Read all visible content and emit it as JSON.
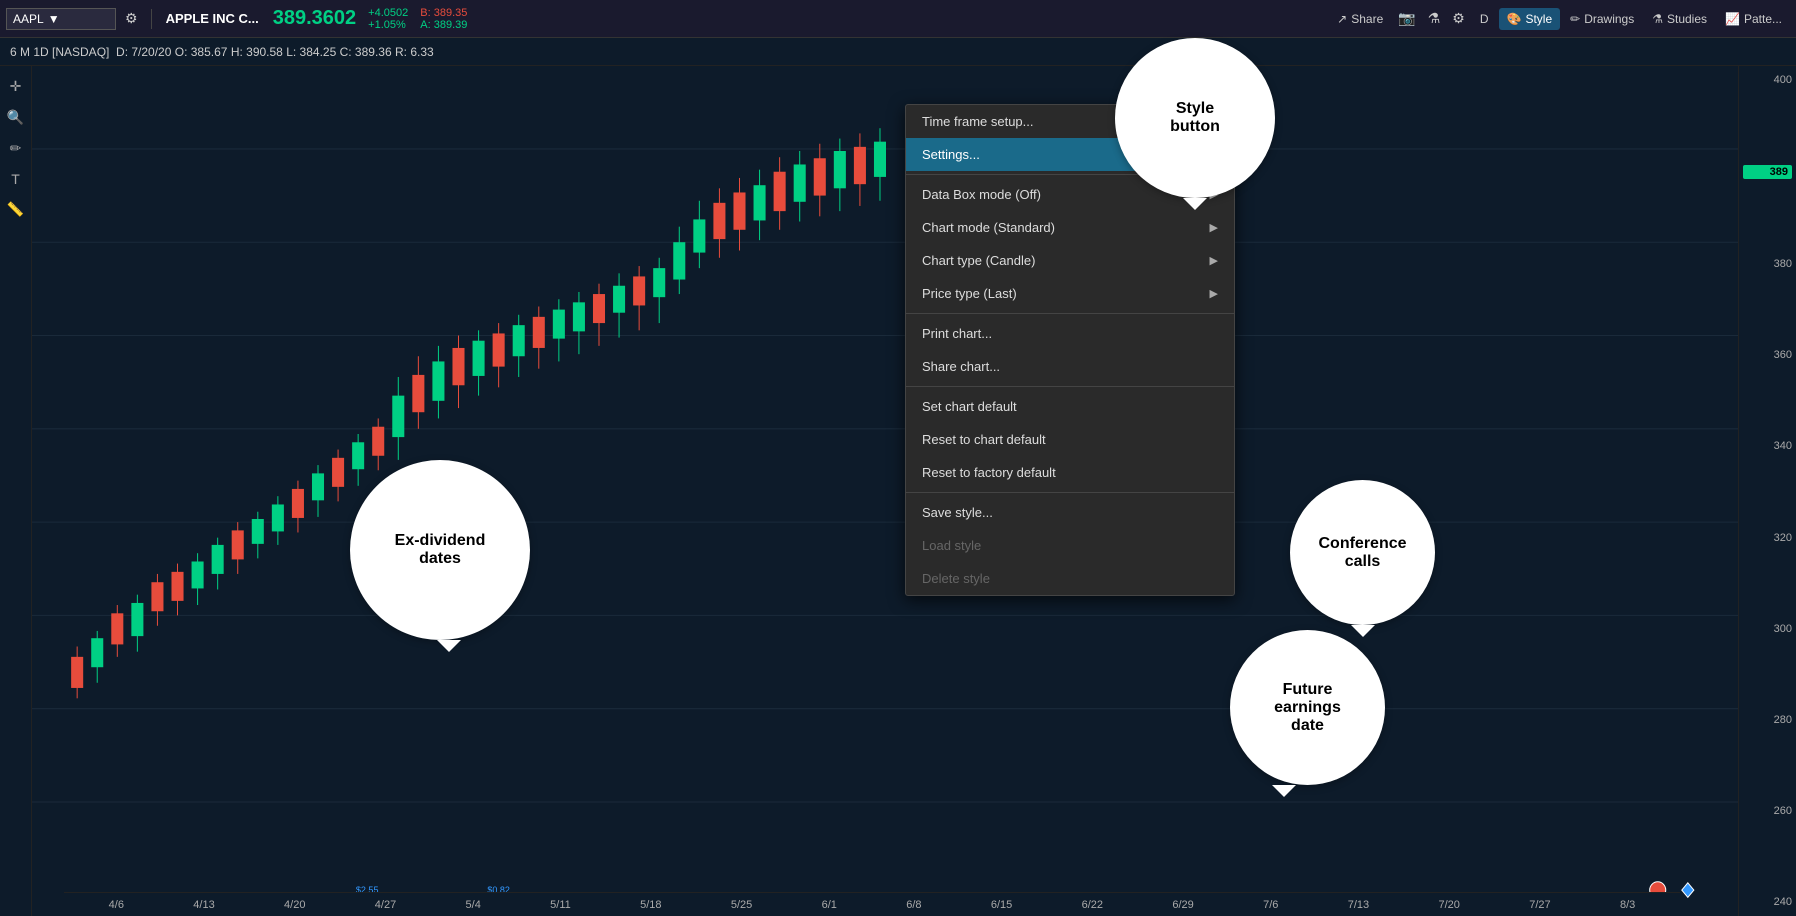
{
  "toolbar": {
    "symbol": "AAPL",
    "symbol_arrow": "▼",
    "settings_icon": "⚙",
    "company_name": "APPLE INC C...",
    "price_main": "389.3602",
    "price_change_pts": "+4.0502",
    "price_change_pct": "+1.05%",
    "bid_label": "B:",
    "bid_value": "389.35",
    "ask_label": "A:",
    "ask_value": "389.39",
    "share_label": "Share",
    "timeframe_label": "D",
    "style_label": "Style",
    "drawings_label": "Drawings",
    "studies_label": "Studies",
    "pattern_label": "Patte..."
  },
  "chart_header": {
    "period": "6 M 1D [NASDAQ]",
    "date": "D: 7/20/20",
    "open": "O: 385.67",
    "high": "H: 390.58",
    "low": "L: 384.25",
    "close": "C: 389.36",
    "range": "R: 6.33"
  },
  "price_axis": {
    "labels": [
      "400",
      "380",
      "360",
      "340",
      "320",
      "300",
      "280",
      "260",
      "240"
    ],
    "current": "389"
  },
  "date_axis": {
    "labels": [
      "4/6",
      "4/13",
      "4/20",
      "4/27",
      "5/4",
      "5/11",
      "5/18",
      "5/25",
      "6/1",
      "6/8",
      "6/15",
      "6/22",
      "6/29",
      "7/6",
      "7/13",
      "7/20",
      "7/27",
      "8/3"
    ]
  },
  "dropdown_menu": {
    "items": [
      {
        "id": "timeframe-setup",
        "label": "Time frame setup...",
        "has_arrow": false,
        "active": false,
        "disabled": false,
        "separator_after": false
      },
      {
        "id": "settings",
        "label": "Settings...",
        "has_arrow": false,
        "active": true,
        "disabled": false,
        "separator_after": false
      },
      {
        "id": "sep1",
        "separator": true
      },
      {
        "id": "databox-mode",
        "label": "Data Box mode (Off)",
        "has_arrow": true,
        "active": false,
        "disabled": false,
        "separator_after": false
      },
      {
        "id": "chart-mode",
        "label": "Chart mode (Standard)",
        "has_arrow": true,
        "active": false,
        "disabled": false,
        "separator_after": false
      },
      {
        "id": "chart-type",
        "label": "Chart type (Candle)",
        "has_arrow": true,
        "active": false,
        "disabled": false,
        "separator_after": false
      },
      {
        "id": "price-type",
        "label": "Price type (Last)",
        "has_arrow": true,
        "active": false,
        "disabled": false,
        "separator_after": false
      },
      {
        "id": "sep2",
        "separator": true
      },
      {
        "id": "print-chart",
        "label": "Print chart...",
        "has_arrow": false,
        "active": false,
        "disabled": false,
        "separator_after": false
      },
      {
        "id": "share-chart",
        "label": "Share chart...",
        "has_arrow": false,
        "active": false,
        "disabled": false,
        "separator_after": false
      },
      {
        "id": "sep3",
        "separator": true
      },
      {
        "id": "set-chart-default",
        "label": "Set chart default",
        "has_arrow": false,
        "active": false,
        "disabled": false,
        "separator_after": false
      },
      {
        "id": "reset-chart-default",
        "label": "Reset to chart default",
        "has_arrow": false,
        "active": false,
        "disabled": false,
        "separator_after": false
      },
      {
        "id": "reset-factory-default",
        "label": "Reset to factory default",
        "has_arrow": false,
        "active": false,
        "disabled": false,
        "separator_after": false
      },
      {
        "id": "sep4",
        "separator": true
      },
      {
        "id": "save-style",
        "label": "Save style...",
        "has_arrow": false,
        "active": false,
        "disabled": false,
        "separator_after": false
      },
      {
        "id": "load-style",
        "label": "Load style",
        "has_arrow": false,
        "active": false,
        "disabled": true,
        "separator_after": false
      },
      {
        "id": "delete-style",
        "label": "Delete style",
        "has_arrow": false,
        "active": false,
        "disabled": true,
        "separator_after": false
      }
    ]
  },
  "callouts": {
    "style_button": "Style\nbutton",
    "ex_dividend": "Ex-dividend\ndates",
    "conference_calls": "Conference\ncalls",
    "future_earnings": "Future\nearnings\ndate"
  }
}
